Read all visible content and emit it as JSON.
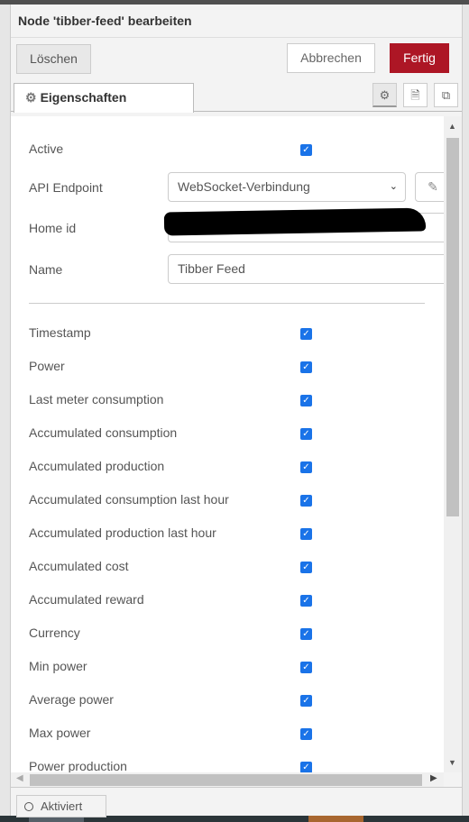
{
  "dialog": {
    "title": "Node 'tibber-feed' bearbeiten",
    "delete_label": "Löschen",
    "cancel_label": "Abbrechen",
    "done_label": "Fertig",
    "accent": "#ad1625"
  },
  "tabs": [
    {
      "label": "Eigenschaften",
      "icon": "gear-icon"
    }
  ],
  "tab_icons": [
    "gear-icon",
    "document-icon",
    "frame-icon"
  ],
  "form": {
    "active_label": "Active",
    "active_checked": true,
    "api_label": "API Endpoint",
    "api_value": "WebSocket-Verbindung",
    "home_label": "Home id",
    "name_label": "Name",
    "name_value": "Tibber Feed"
  },
  "fields": [
    {
      "label": "Timestamp",
      "checked": true
    },
    {
      "label": "Power",
      "checked": true
    },
    {
      "label": "Last meter consumption",
      "checked": true
    },
    {
      "label": "Accumulated consumption",
      "checked": true
    },
    {
      "label": "Accumulated production",
      "checked": true
    },
    {
      "label": "Accumulated consumption last hour",
      "checked": true
    },
    {
      "label": "Accumulated production last hour",
      "checked": true
    },
    {
      "label": "Accumulated cost",
      "checked": true
    },
    {
      "label": "Accumulated reward",
      "checked": true
    },
    {
      "label": "Currency",
      "checked": true
    },
    {
      "label": "Min power",
      "checked": true
    },
    {
      "label": "Average power",
      "checked": true
    },
    {
      "label": "Max power",
      "checked": true
    },
    {
      "label": "Power production",
      "checked": true
    }
  ],
  "footer": {
    "enabled_label": "Aktiviert"
  }
}
